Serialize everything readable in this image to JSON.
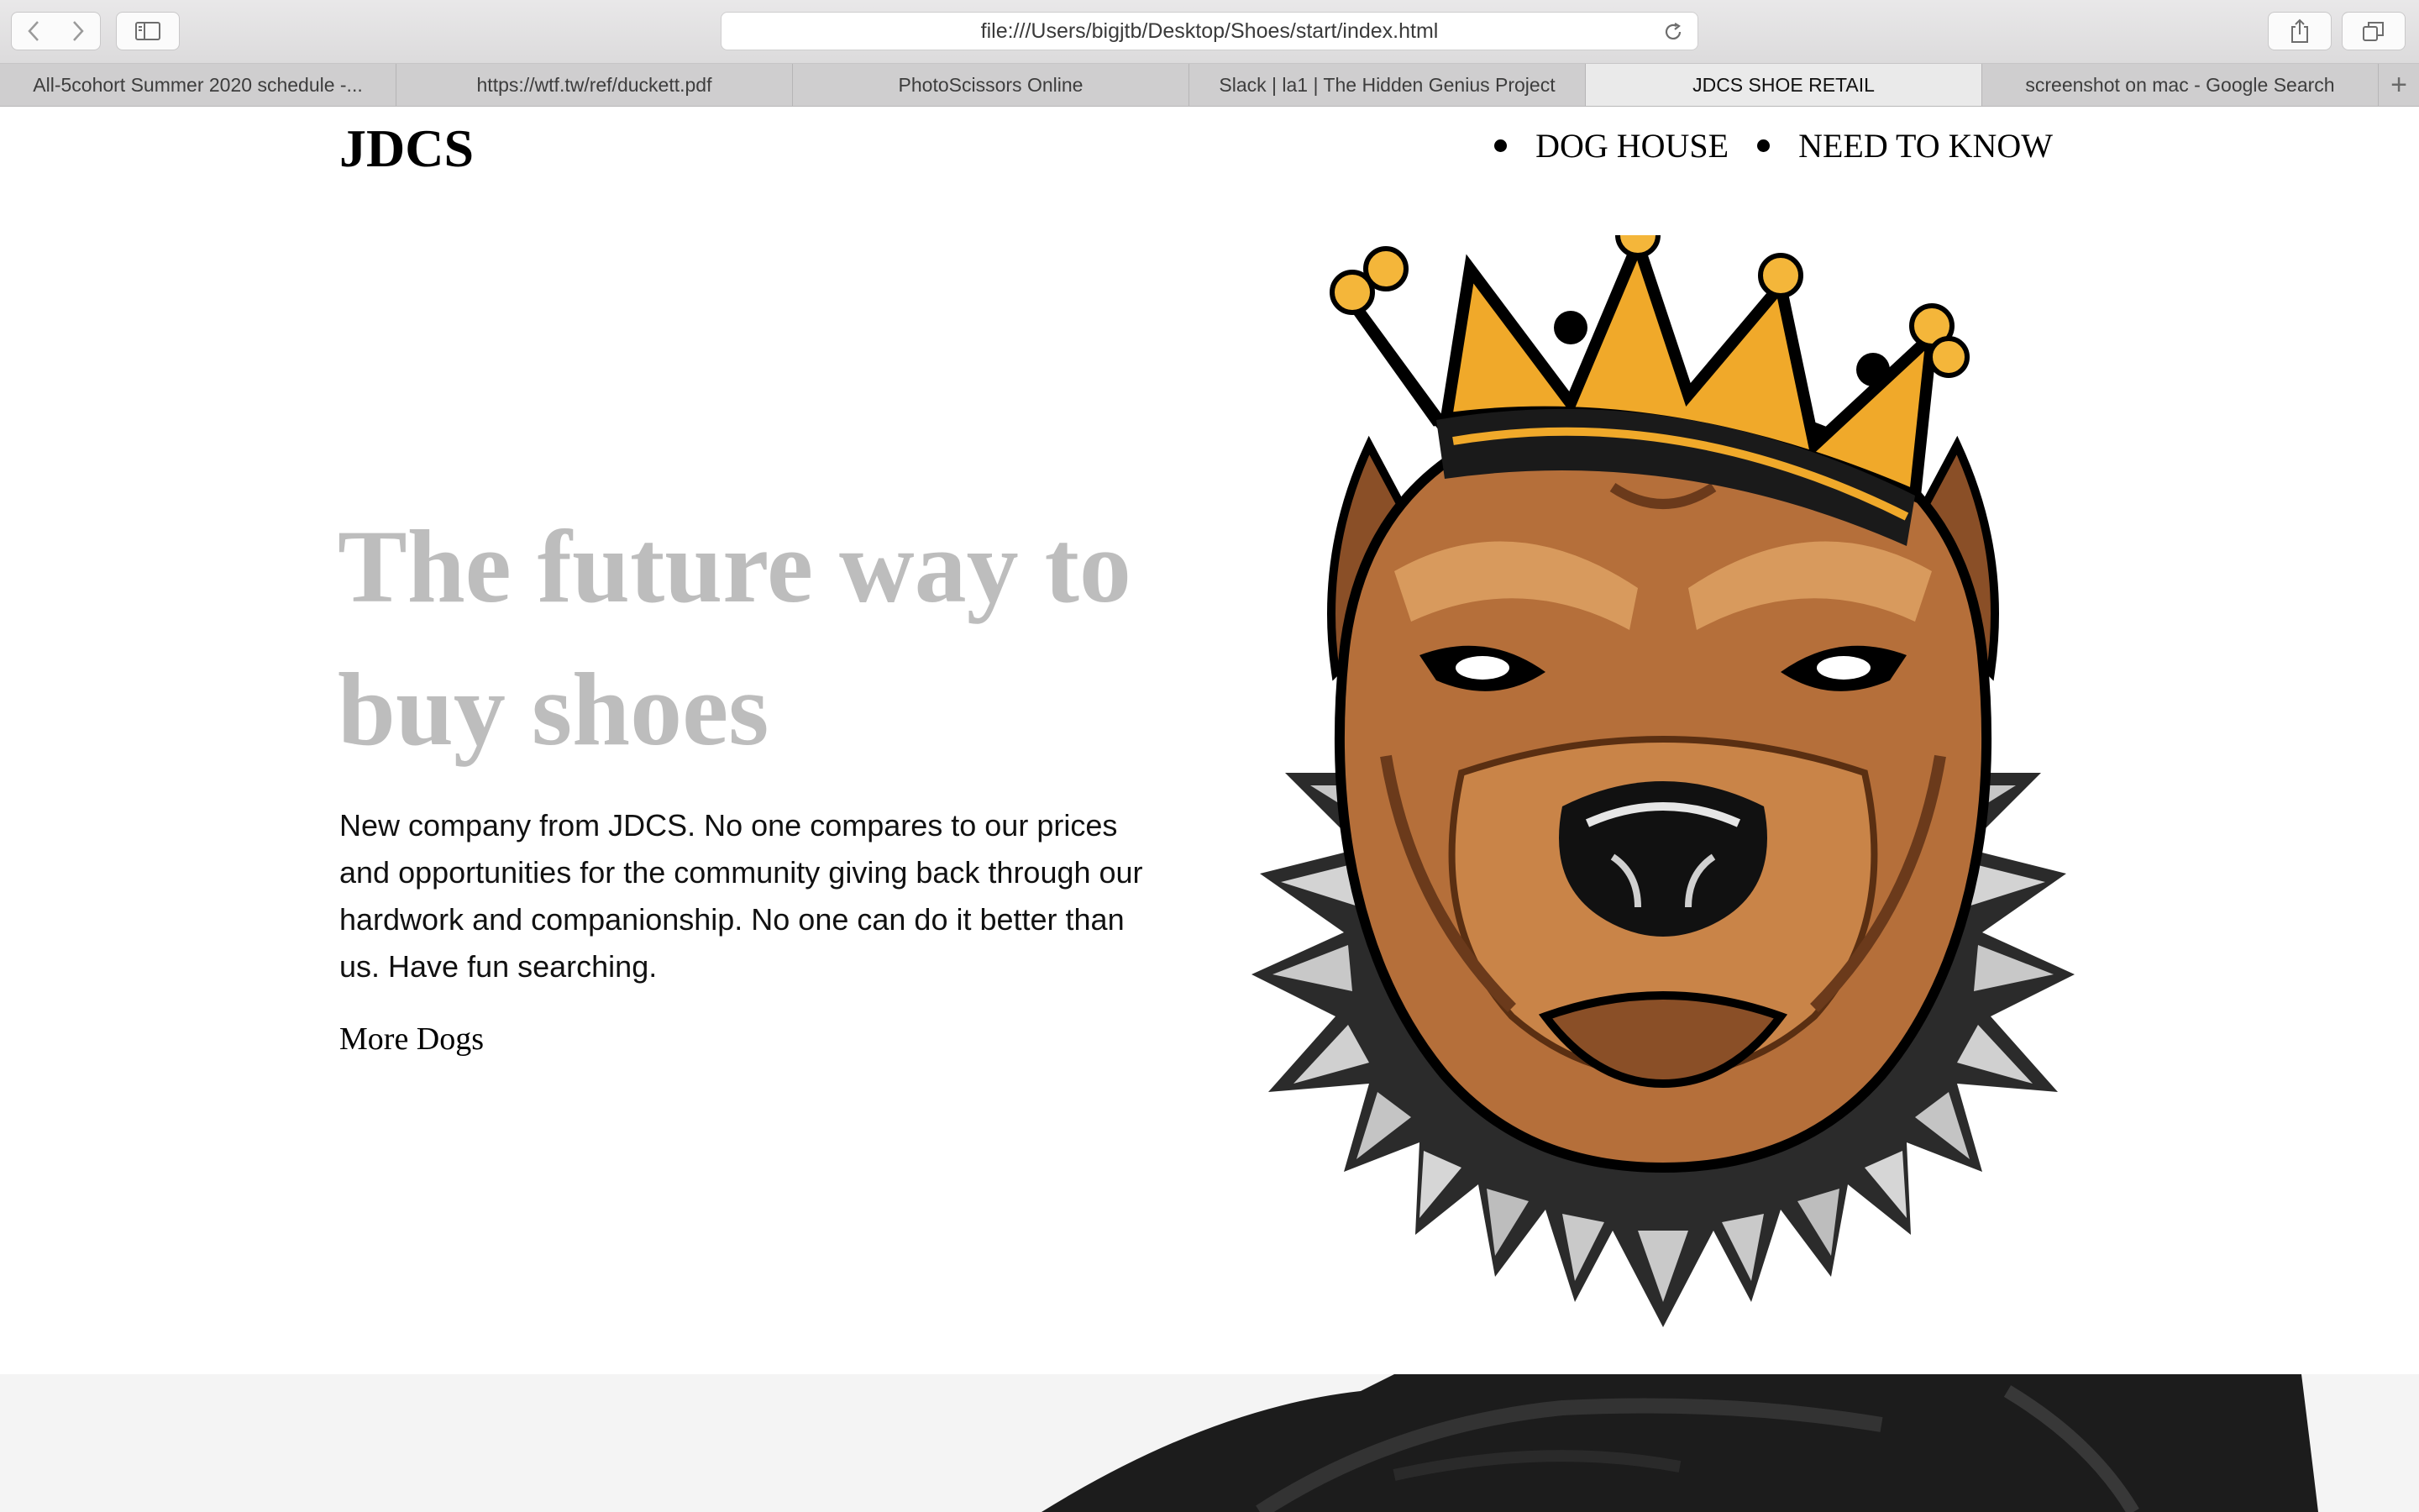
{
  "browser": {
    "url": "file:///Users/bigjtb/Desktop/Shoes/start/index.html",
    "tabs": [
      {
        "label": "All-5cohort Summer 2020 schedule -...",
        "active": false
      },
      {
        "label": "https://wtf.tw/ref/duckett.pdf",
        "active": false
      },
      {
        "label": "PhotoScissors Online",
        "active": false
      },
      {
        "label": "Slack | la1 | The Hidden Genius Project",
        "active": false
      },
      {
        "label": "JDCS SHOE RETAIL",
        "active": true
      },
      {
        "label": "screenshot on mac - Google Search",
        "active": false
      }
    ],
    "icons": [
      "back-icon",
      "forward-icon",
      "sidebar-icon",
      "reload-icon",
      "share-icon",
      "tabs-overview-icon",
      "new-tab-icon"
    ]
  },
  "header": {
    "logo": "JDCS",
    "nav": [
      "DOG HOUSE",
      "NEED TO KNOW"
    ]
  },
  "hero": {
    "title": "The future way to buy shoes",
    "text": "New company from JDCS. No one compares to our prices and opportunities for the community giving back through our hardwork and companionship. No one can do it better than us. Have fun searching.",
    "link": "More Dogs"
  },
  "colors": {
    "title_gray": "#bdbdbd",
    "dog_brown": "#b56f3a",
    "crown_gold": "#f0a92a",
    "band_bg": "#f4f4f4"
  }
}
